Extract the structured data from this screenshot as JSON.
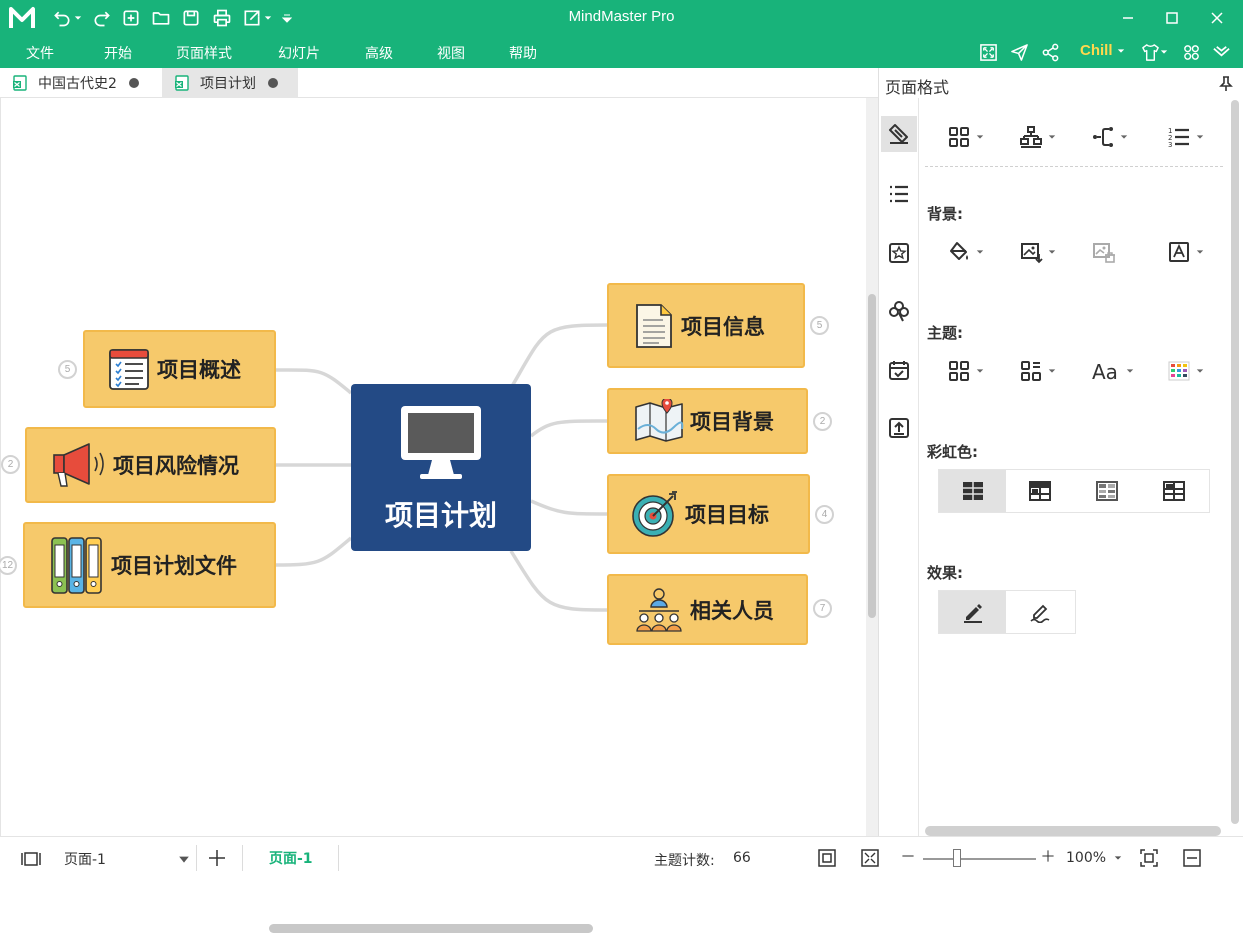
{
  "app": {
    "title": "MindMaster Pro",
    "theme_color": "#18b37a"
  },
  "menu": {
    "items": [
      "文件",
      "开始",
      "页面样式",
      "幻灯片",
      "高级",
      "视图",
      "帮助"
    ],
    "theme_label": "Chill",
    "theme_label_color": "#ffd84d"
  },
  "tabs": [
    {
      "label": "中国古代史2",
      "active": false
    },
    {
      "label": "项目计划",
      "active": true
    }
  ],
  "mindmap": {
    "central": {
      "label": "项目计划",
      "icon": "monitor-icon",
      "color": "#234a85"
    },
    "topic_color": "#f6c96b",
    "right": [
      {
        "label": "项目信息",
        "icon": "document-icon",
        "count": "5"
      },
      {
        "label": "项目背景",
        "icon": "map-icon",
        "count": "2"
      },
      {
        "label": "项目目标",
        "icon": "target-icon",
        "count": "4"
      },
      {
        "label": "相关人员",
        "icon": "people-icon",
        "count": "7"
      }
    ],
    "left": [
      {
        "label": "项目概述",
        "icon": "checklist-icon",
        "count": "5"
      },
      {
        "label": "项目风险情况",
        "icon": "megaphone-icon",
        "count": "2"
      },
      {
        "label": "项目计划文件",
        "icon": "binders-icon",
        "count": "12"
      }
    ]
  },
  "panel": {
    "title": "页面格式",
    "sections": {
      "background": "背景:",
      "theme": "主题:",
      "rainbow": "彩虹色:",
      "effect": "效果:"
    }
  },
  "status": {
    "page_select": "页面-1",
    "page_tab": "页面-1",
    "topic_count_label": "主题计数:",
    "topic_count": "66",
    "zoom": "100%",
    "zoom_fraction": 0.3
  }
}
